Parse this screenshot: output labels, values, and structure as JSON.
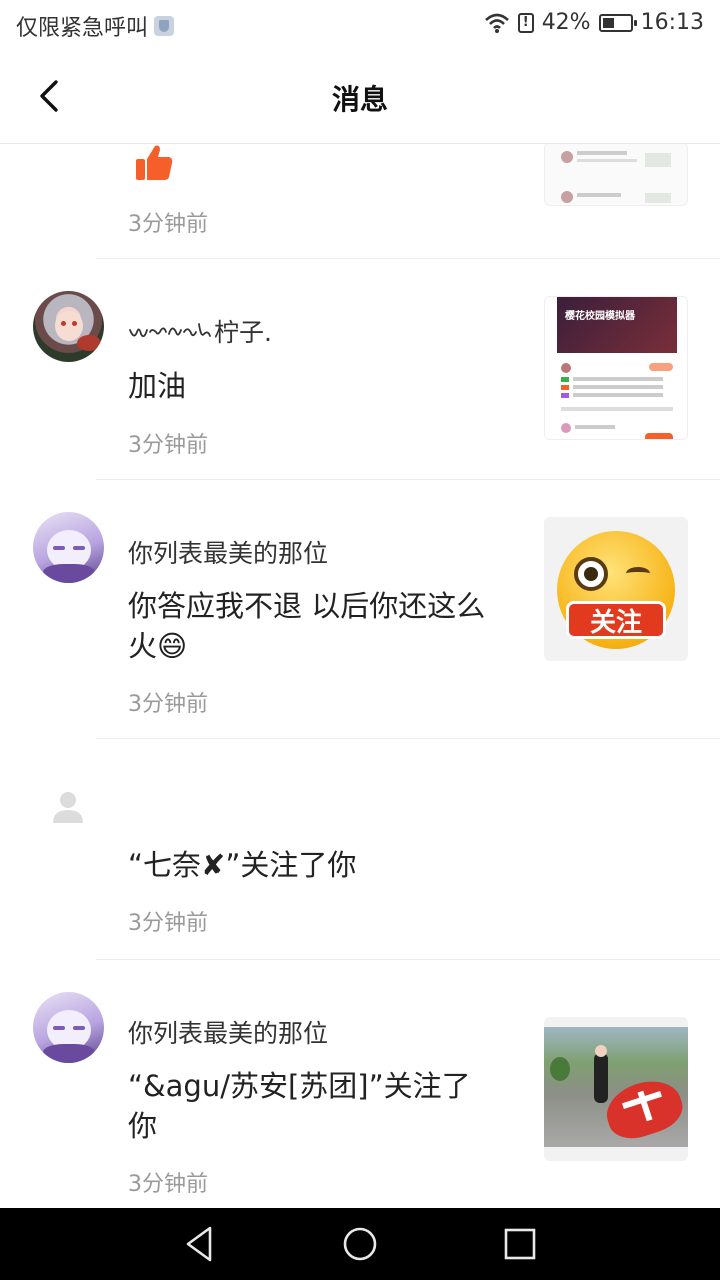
{
  "status_bar": {
    "carrier": "仅限紧急呼叫",
    "battery": "42%",
    "battery_level": 0.42,
    "time": "16:13"
  },
  "header": {
    "title": "消息"
  },
  "messages": [
    {
      "time": "3分钟前"
    },
    {
      "name": "",
      "message": "加油",
      "time": "3分钟前",
      "thumb_title": "樱花校园模拟器"
    },
    {
      "name": "你列表最美的那位",
      "message": "你答应我不退  以后你还这么火😄",
      "time": "3分钟前",
      "sticker_text": "关注"
    },
    {
      "message": "“七奈✘”关注了你",
      "time": "3分钟前"
    },
    {
      "name": "你列表最美的那位",
      "message": "“&agu/苏安[苏团]”关注了你",
      "time": "3分钟前"
    }
  ],
  "name_suffix": "柠子.",
  "colors": {
    "accent": "#f5602a",
    "text_secondary": "#9a9a9a",
    "divider": "#ececec"
  }
}
